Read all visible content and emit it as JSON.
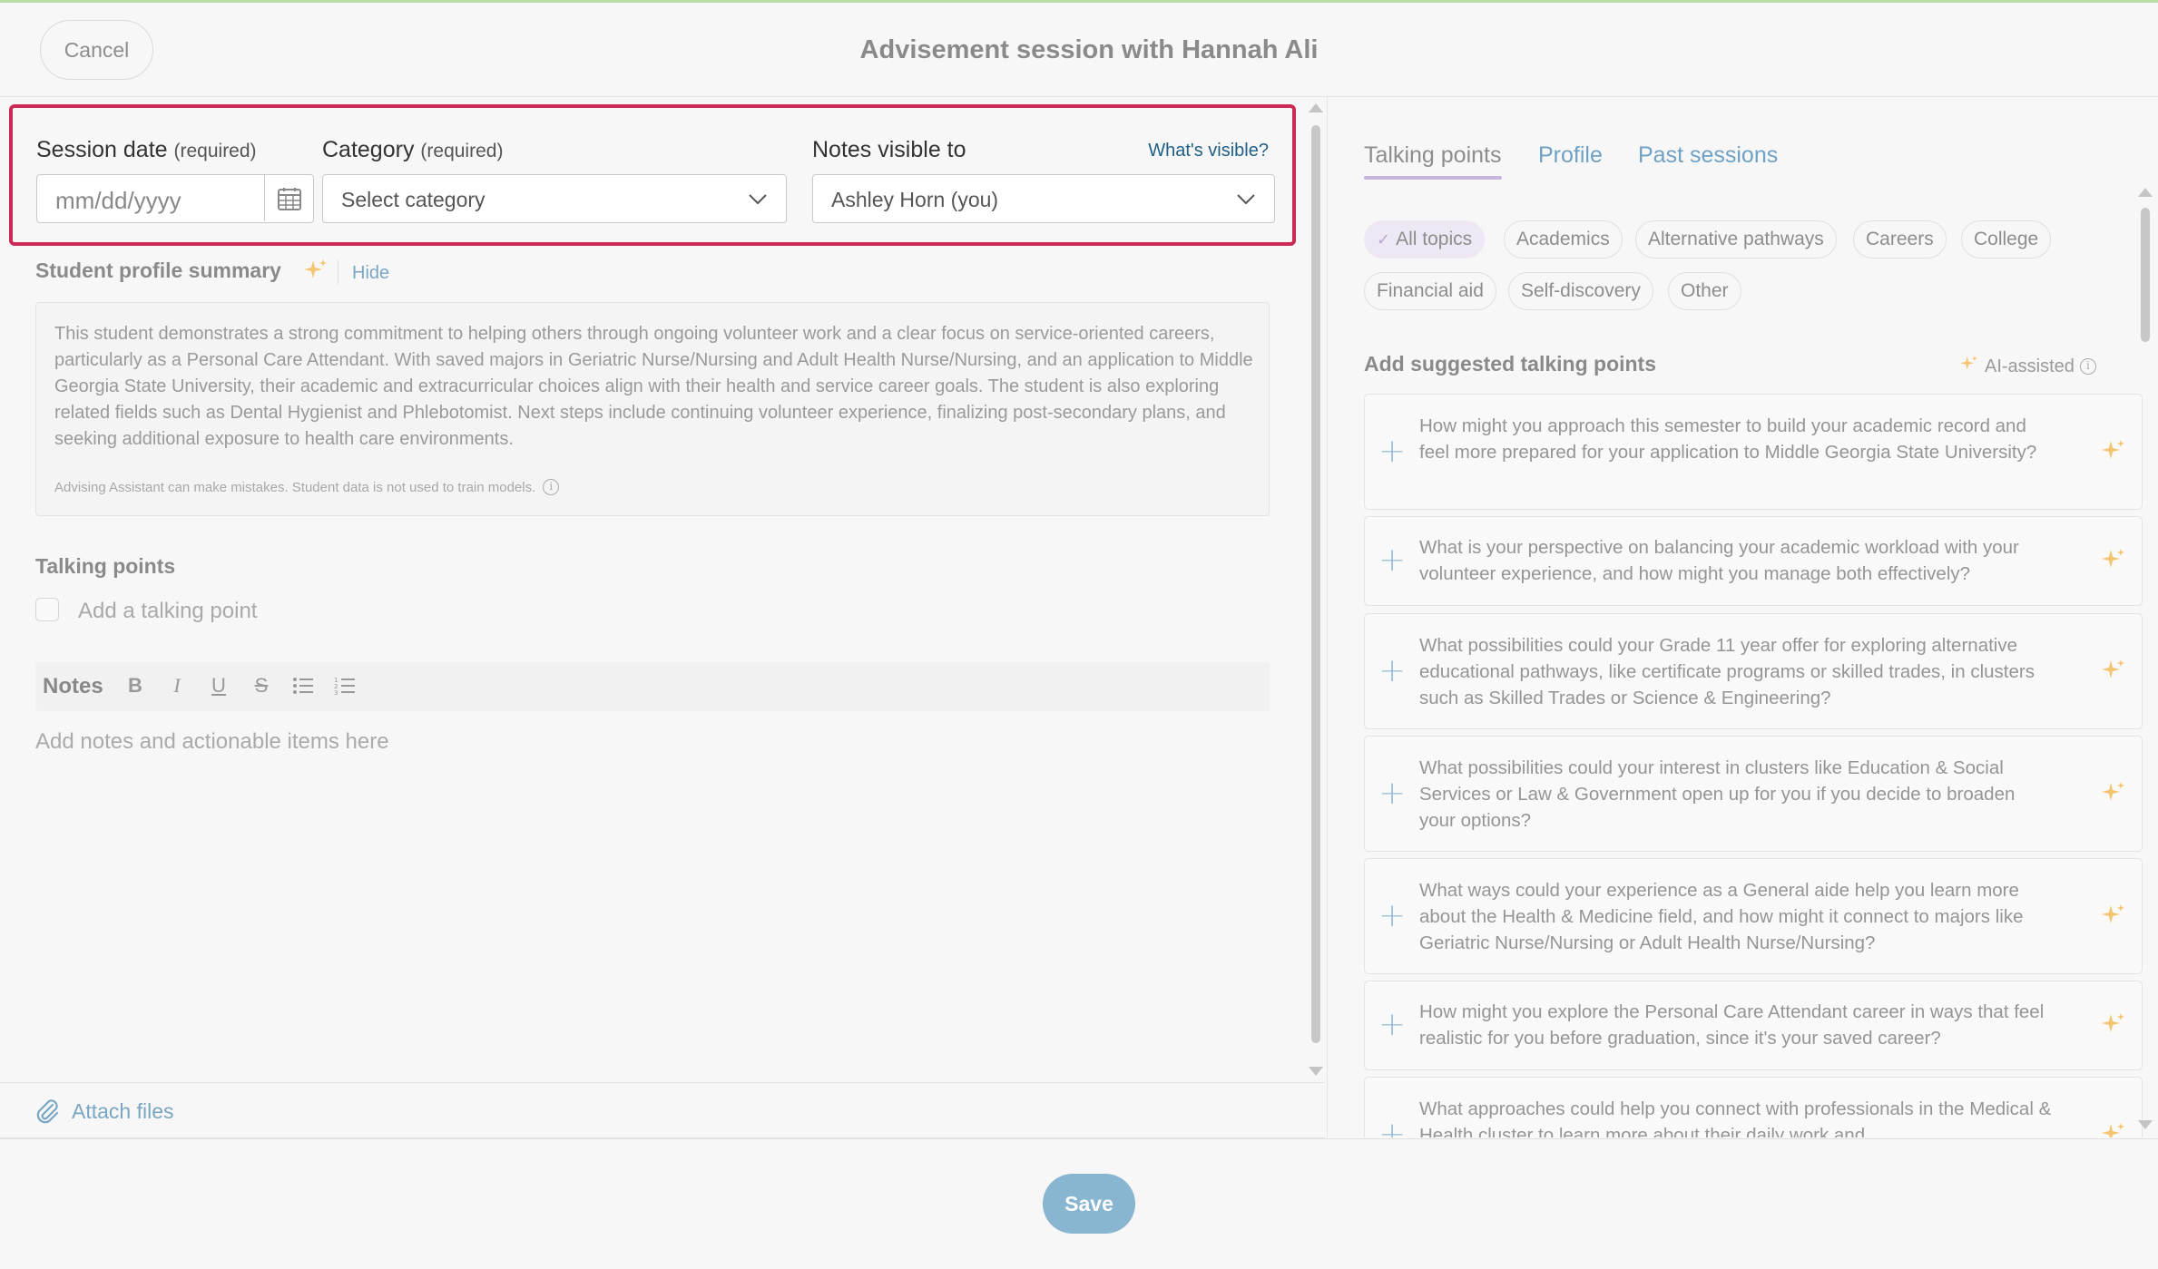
{
  "header": {
    "cancel_label": "Cancel",
    "title": "Advisement session with Hannah Ali"
  },
  "form": {
    "session_date_label": "Session date",
    "session_date_req": "(required)",
    "session_date_placeholder": "mm/dd/yyyy",
    "category_label": "Category",
    "category_req": "(required)",
    "category_value": "Select category",
    "visibility_label": "Notes visible to",
    "whats_visible": "What's visible?",
    "visibility_value": "Ashley Horn (you)"
  },
  "summary": {
    "title": "Student profile summary",
    "hide_label": "Hide",
    "text": "This student demonstrates a strong commitment to helping others through ongoing volunteer work and a clear focus on service-oriented careers, particularly as a Personal Care Attendant. With saved majors in Geriatric Nurse/Nursing and Adult Health Nurse/Nursing, and an application to Middle Georgia State University, their academic and extracurricular choices align with their health and service career goals. The student is also exploring related fields such as Dental Hygienist and Phlebotomist. Next steps include continuing volunteer experience, finalizing post-secondary plans, and seeking additional exposure to health care environments.",
    "disclaimer": "Advising Assistant can make mistakes. Student data is not used to train models."
  },
  "talking_points": {
    "title": "Talking points",
    "add_placeholder": "Add a talking point"
  },
  "notes": {
    "label": "Notes",
    "placeholder": "Add notes and actionable items here",
    "tools": [
      "B",
      "I",
      "U",
      "S"
    ]
  },
  "attach": {
    "label": "Attach files"
  },
  "right": {
    "tabs": [
      "Talking points",
      "Profile",
      "Past sessions"
    ],
    "active_tab": "Talking points",
    "chips": [
      "All topics",
      "Academics",
      "Alternative pathways",
      "Careers",
      "College",
      "Financial aid",
      "Self-discovery",
      "Other"
    ],
    "selected_chip": "All topics",
    "suggest_title": "Add suggested talking points",
    "ai_label": "AI-assisted",
    "suggestions": [
      "How might you approach this semester to build your academic record and feel more prepared for your application to Middle Georgia State University?",
      "What is your perspective on balancing your academic workload with your volunteer experience, and how might you manage both effectively?",
      "What possibilities could your Grade 11 year offer for exploring alternative educational pathways, like certificate programs or skilled trades, in clusters such as Skilled Trades or Science & Engineering?",
      "What possibilities could your interest in clusters like Education & Social Services or Law & Government open up for you if you decide to broaden your options?",
      "What ways could your experience as a General aide help you learn more about the Health & Medicine field, and how might it connect to majors like Geriatric Nurse/Nursing or Adult Health Nurse/Nursing?",
      "How might you explore the Personal Care Attendant career in ways that feel realistic for you before graduation, since it's your saved career?",
      "What approaches could help you connect with professionals in the Medical & Health cluster to learn more about their daily work and"
    ]
  },
  "footer": {
    "save_label": "Save"
  },
  "colors": {
    "highlight_border": "#cc2a55",
    "accent_link": "#1f5f86",
    "save_button": "#88b6d0",
    "sparkle": "#f5c470"
  }
}
